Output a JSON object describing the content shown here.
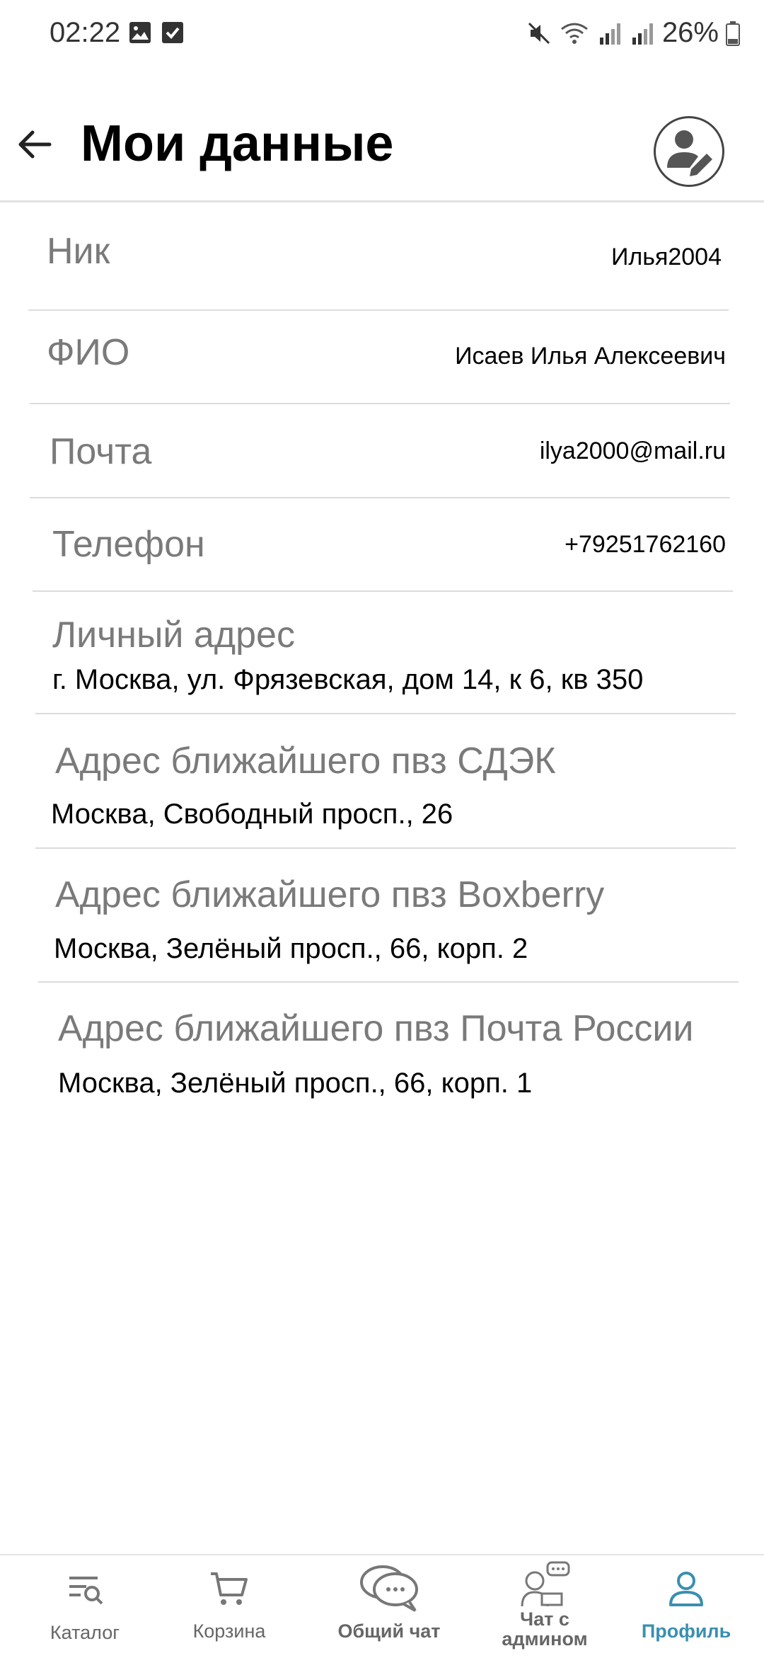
{
  "status_bar": {
    "time": "02:22",
    "battery": "26%"
  },
  "header": {
    "title": "Мои данные"
  },
  "fields": {
    "nick_label": "Ник",
    "nick_value": "Илья2004",
    "fio_label": "ФИО",
    "fio_value": "Исаев Илья Алексеевич",
    "email_label": "Почта",
    "email_value": "ilya2000@mail.ru",
    "phone_label": "Телефон",
    "phone_value": "+79251762160",
    "address_label": "Личный адрес",
    "address_value": "г. Москва, ул. Фрязевская, дом 14, к 6, кв 350",
    "cdek_label": "Адрес ближайшего пвз СДЭК",
    "cdek_value": "Москва, Свободный просп., 26",
    "boxberry_label": "Адрес ближайшего пвз Boxberry",
    "boxberry_value": "Москва, Зелёный просп., 66, корп. 2",
    "post_label": "Адрес ближайшего пвз Почта России",
    "post_value": "Москва, Зелёный просп., 66, корп. 1"
  },
  "nav": {
    "catalog": "Каталог",
    "cart": "Корзина",
    "common_chat": "Общий чат",
    "admin_chat_line1": "Чат с",
    "admin_chat_line2": "админом",
    "profile": "Профиль"
  },
  "colors": {
    "accent": "#3a8fb0",
    "label_gray": "#7a7a7a"
  }
}
